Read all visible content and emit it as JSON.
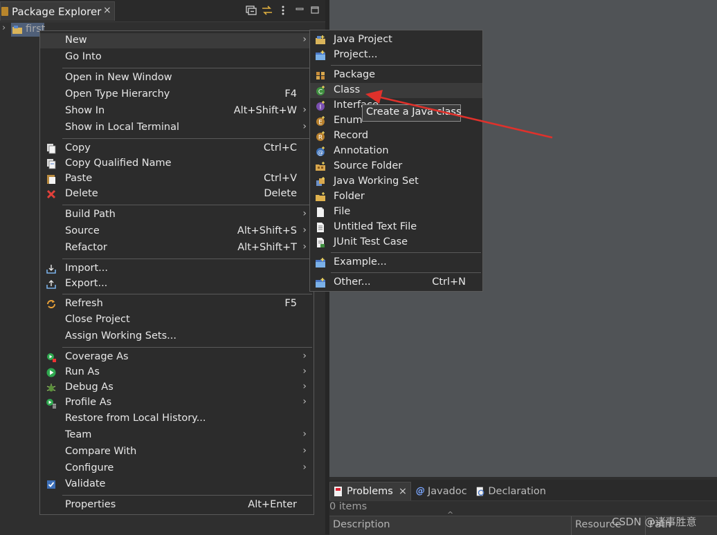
{
  "left_view": {
    "tab_label": "Package Explorer",
    "tab_close": "×",
    "project_name": "first"
  },
  "context_menu": {
    "groups": [
      [
        {
          "label": "New",
          "submenu": true,
          "highlight": true
        },
        {
          "label": "Go Into"
        }
      ],
      [
        {
          "label": "Open in New Window"
        },
        {
          "label": "Open Type Hierarchy",
          "shortcut": "F4"
        },
        {
          "label": "Show In",
          "shortcut": "Alt+Shift+W",
          "submenu": true
        },
        {
          "label": "Show in Local Terminal",
          "submenu": true
        }
      ],
      [
        {
          "label": "Copy",
          "shortcut": "Ctrl+C",
          "icon": "copy-icon"
        },
        {
          "label": "Copy Qualified Name",
          "icon": "copy-qualified-icon"
        },
        {
          "label": "Paste",
          "shortcut": "Ctrl+V",
          "icon": "paste-icon"
        },
        {
          "label": "Delete",
          "shortcut": "Delete",
          "icon": "delete-icon"
        }
      ],
      [
        {
          "label": "Build Path",
          "submenu": true
        },
        {
          "label": "Source",
          "shortcut": "Alt+Shift+S",
          "submenu": true
        },
        {
          "label": "Refactor",
          "shortcut": "Alt+Shift+T",
          "submenu": true
        }
      ],
      [
        {
          "label": "Import...",
          "icon": "import-icon"
        },
        {
          "label": "Export...",
          "icon": "export-icon"
        }
      ],
      [
        {
          "label": "Refresh",
          "shortcut": "F5",
          "icon": "refresh-icon"
        },
        {
          "label": "Close Project"
        },
        {
          "label": "Assign Working Sets..."
        }
      ],
      [
        {
          "label": "Coverage As",
          "submenu": true,
          "icon": "coverage-icon"
        },
        {
          "label": "Run As",
          "submenu": true,
          "icon": "run-icon"
        },
        {
          "label": "Debug As",
          "submenu": true,
          "icon": "debug-icon"
        },
        {
          "label": "Profile As",
          "submenu": true,
          "icon": "profile-icon"
        },
        {
          "label": "Restore from Local History..."
        },
        {
          "label": "Team",
          "submenu": true
        },
        {
          "label": "Compare With",
          "submenu": true
        },
        {
          "label": "Configure",
          "submenu": true
        },
        {
          "label": "Validate",
          "icon": "validate-check-icon"
        }
      ],
      [
        {
          "label": "Properties",
          "shortcut": "Alt+Enter"
        }
      ]
    ]
  },
  "new_submenu": {
    "groups": [
      [
        {
          "label": "Java Project",
          "icon": "java-project-icon"
        },
        {
          "label": "Project...",
          "icon": "project-icon"
        }
      ],
      [
        {
          "label": "Package",
          "icon": "package-icon"
        },
        {
          "label": "Class",
          "icon": "class-icon",
          "highlight": true
        },
        {
          "label": "Interface",
          "icon": "interface-icon"
        },
        {
          "label": "Enum",
          "icon": "enum-icon"
        },
        {
          "label": "Record",
          "icon": "record-icon"
        },
        {
          "label": "Annotation",
          "icon": "annotation-icon"
        },
        {
          "label": "Source Folder",
          "icon": "source-folder-icon"
        },
        {
          "label": "Java Working Set",
          "icon": "working-set-icon"
        },
        {
          "label": "Folder",
          "icon": "folder-icon"
        },
        {
          "label": "File",
          "icon": "file-icon"
        },
        {
          "label": "Untitled Text File",
          "icon": "text-file-icon"
        },
        {
          "label": "JUnit Test Case",
          "icon": "junit-icon"
        }
      ],
      [
        {
          "label": "Example...",
          "icon": "example-icon"
        }
      ],
      [
        {
          "label": "Other...",
          "shortcut": "Ctrl+N",
          "icon": "other-icon"
        }
      ]
    ]
  },
  "tooltip": "Create a Java class",
  "bottom_panel": {
    "tabs": [
      {
        "label": "Problems",
        "icon": "problems-icon",
        "active": true,
        "close": "×"
      },
      {
        "label": "Javadoc",
        "icon": "javadoc-icon"
      },
      {
        "label": "Declaration",
        "icon": "declaration-icon"
      }
    ],
    "item_count": "0 items",
    "columns": [
      "Description",
      "Resource",
      "Path"
    ]
  },
  "watermark": "CSDN @诸事胜意",
  "colors": {
    "annotation_arrow": "#e0312b",
    "menu_bg": "#2c2c2c",
    "highlight_bg": "#3b3b3b"
  }
}
